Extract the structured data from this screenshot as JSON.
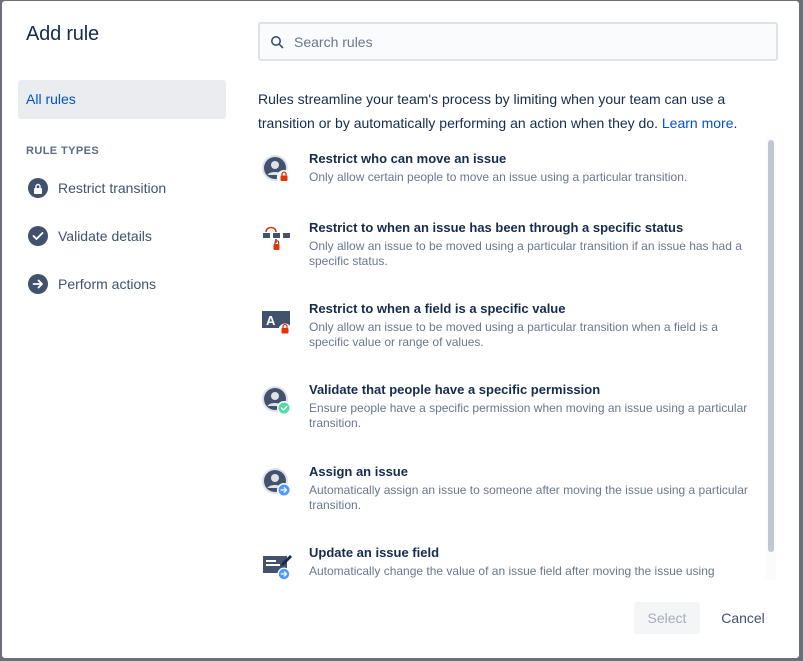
{
  "modal": {
    "title": "Add rule"
  },
  "sidebar": {
    "all_rules": "All rules",
    "section_label": "RULE TYPES",
    "items": [
      {
        "label": "Restrict transition",
        "icon": "lock-icon"
      },
      {
        "label": "Validate details",
        "icon": "check-icon"
      },
      {
        "label": "Perform actions",
        "icon": "arrow-right-icon"
      }
    ]
  },
  "search": {
    "placeholder": "Search rules",
    "value": ""
  },
  "intro": {
    "text": "Rules streamline your team's process by limiting when your team can use a transition or by automatically performing an action when they do.",
    "link": "Learn more"
  },
  "rules": [
    {
      "title": "Restrict who can move an issue",
      "desc": "Only allow certain people to move an issue using a particular transition.",
      "icon": "user-lock-icon"
    },
    {
      "title": "Restrict to when an issue has been through a specific status",
      "desc": "Only allow an issue to be moved using a particular transition if an issue has had a specific status.",
      "icon": "status-lock-icon"
    },
    {
      "title": "Restrict to when a field is a specific value",
      "desc": "Only allow an issue to be moved using a particular transition when a field is a specific value or range of values.",
      "icon": "field-lock-icon"
    },
    {
      "title": "Validate that people have a specific permission",
      "desc": "Ensure people have a specific permission when moving an issue using a particular transition.",
      "icon": "user-check-icon"
    },
    {
      "title": "Assign an issue",
      "desc": "Automatically assign an issue to someone after moving the issue using a particular transition.",
      "icon": "user-arrow-icon"
    },
    {
      "title": "Update an issue field",
      "desc": "Automatically change the value of an issue field after moving the issue using",
      "icon": "field-edit-icon"
    }
  ],
  "footer": {
    "select_label": "Select",
    "cancel_label": "Cancel"
  },
  "colors": {
    "accent": "#0052cc",
    "lock": "#de350b",
    "check": "#36b37e",
    "arrow": "#4c9aff",
    "icon_dark": "#42526e"
  }
}
